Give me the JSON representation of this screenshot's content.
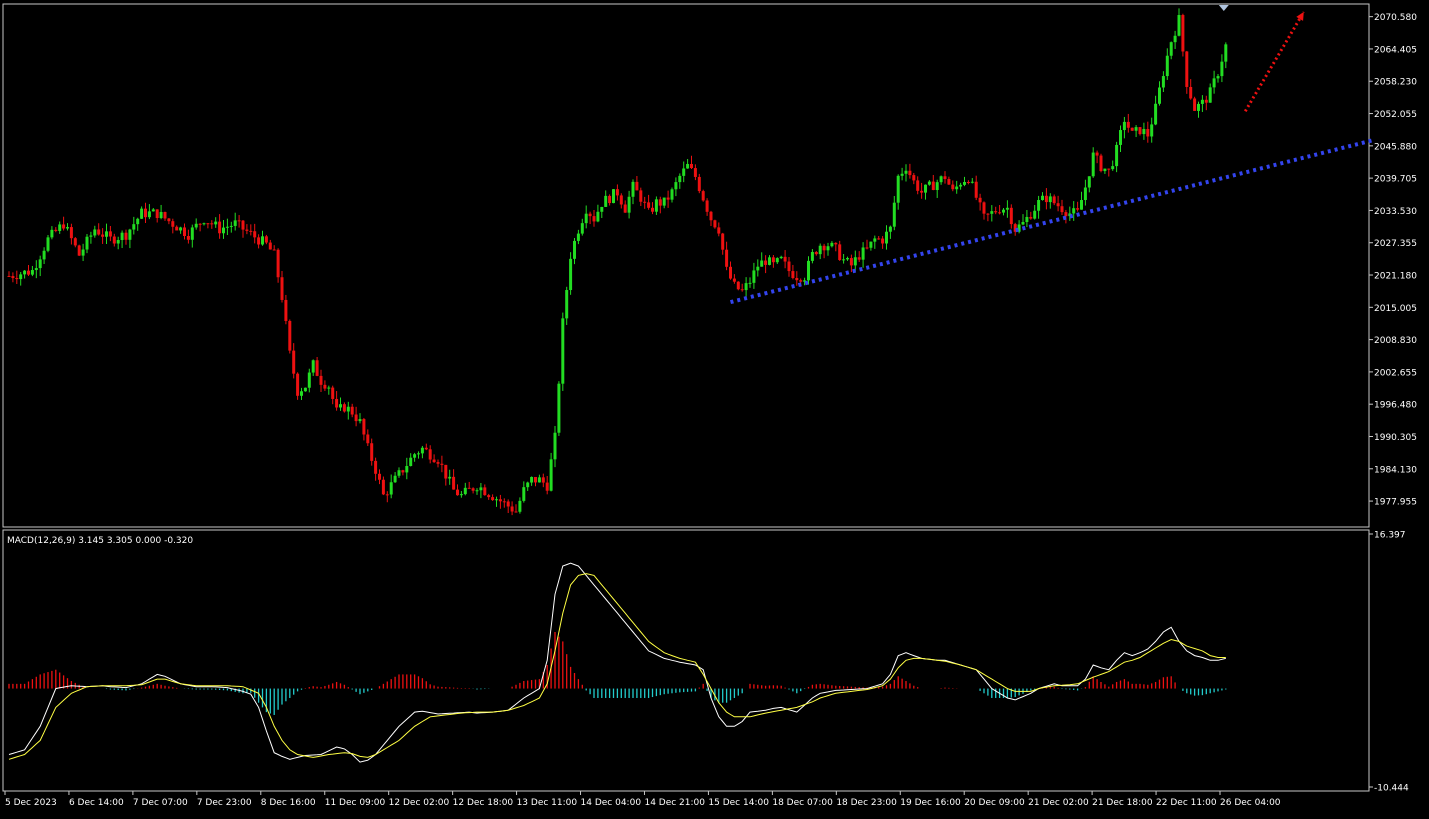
{
  "colors": {
    "background": "#000000",
    "frame": "#c8c8c8",
    "bull": "#22dd22",
    "bear": "#ee1111",
    "trendline": "#3344ee",
    "arrow": "#ee1111",
    "macd_line": "#ffffff",
    "signal_line": "#ffff44",
    "hist_pos": "#ee1111",
    "hist_neg": "#22cccc",
    "text": "#ffffff"
  },
  "chart_data": [
    {
      "type": "candlestick",
      "symbol_panel": "main",
      "ylim": [
        1973.0,
        2073.0
      ],
      "y_ticks": [
        "2070.580",
        "2064.405",
        "2058.230",
        "2052.055",
        "2045.880",
        "2039.705",
        "2033.530",
        "2027.355",
        "2021.180",
        "2015.005",
        "2008.830",
        "2002.655",
        "1996.480",
        "1990.305",
        "1984.130",
        "1977.955"
      ],
      "x_tick_labels": [
        "5 Dec 2023",
        "6 Dec 14:00",
        "7 Dec 07:00",
        "7 Dec 23:00",
        "8 Dec 16:00",
        "11 Dec 09:00",
        "12 Dec 02:00",
        "12 Dec 18:00",
        "13 Dec 11:00",
        "14 Dec 04:00",
        "14 Dec 21:00",
        "15 Dec 14:00",
        "18 Dec 07:00",
        "18 Dec 23:00",
        "19 Dec 16:00",
        "20 Dec 09:00",
        "21 Dec 02:00",
        "21 Dec 18:00",
        "22 Dec 11:00",
        "26 Dec 04:00"
      ],
      "close_path": [
        [
          0,
          2021
        ],
        [
          6,
          2022
        ],
        [
          10,
          2028
        ],
        [
          14,
          2031
        ],
        [
          18,
          2025
        ],
        [
          22,
          2030
        ],
        [
          26,
          2028
        ],
        [
          30,
          2029
        ],
        [
          34,
          2033
        ],
        [
          38,
          2033
        ],
        [
          42,
          2031
        ],
        [
          46,
          2029
        ],
        [
          50,
          2032
        ],
        [
          54,
          2030
        ],
        [
          58,
          2031
        ],
        [
          62,
          2029
        ],
        [
          66,
          2027
        ],
        [
          68,
          2025
        ],
        [
          70,
          2017
        ],
        [
          72,
          2006
        ],
        [
          74,
          1999
        ],
        [
          76,
          2000
        ],
        [
          78,
          2004
        ],
        [
          80,
          2001
        ],
        [
          82,
          2000
        ],
        [
          84,
          1995
        ],
        [
          86,
          1996
        ],
        [
          88,
          1995
        ],
        [
          90,
          1993
        ],
        [
          92,
          1988
        ],
        [
          94,
          1984
        ],
        [
          96,
          1979
        ],
        [
          98,
          1981
        ],
        [
          100,
          1983
        ],
        [
          102,
          1985
        ],
        [
          104,
          1987
        ],
        [
          106,
          1988
        ],
        [
          108,
          1987
        ],
        [
          110,
          1986
        ],
        [
          112,
          1983
        ],
        [
          114,
          1980
        ],
        [
          116,
          1979
        ],
        [
          118,
          1980
        ],
        [
          120,
          1981
        ],
        [
          122,
          1980
        ],
        [
          124,
          1979
        ],
        [
          126,
          1978
        ],
        [
          128,
          1977
        ],
        [
          130,
          1976
        ],
        [
          132,
          1980
        ],
        [
          134,
          1982
        ],
        [
          136,
          1982
        ],
        [
          138,
          1981
        ],
        [
          140,
          1990
        ],
        [
          142,
          2012
        ],
        [
          144,
          2025
        ],
        [
          146,
          2030
        ],
        [
          148,
          2034
        ],
        [
          150,
          2032
        ],
        [
          152,
          2035
        ],
        [
          154,
          2036
        ],
        [
          156,
          2037
        ],
        [
          158,
          2034
        ],
        [
          160,
          2038
        ],
        [
          162,
          2036
        ],
        [
          164,
          2033
        ],
        [
          166,
          2035
        ],
        [
          168,
          2035
        ],
        [
          170,
          2037
        ],
        [
          172,
          2040
        ],
        [
          174,
          2042
        ],
        [
          176,
          2040
        ],
        [
          178,
          2036
        ],
        [
          180,
          2032
        ],
        [
          182,
          2030
        ],
        [
          184,
          2022
        ],
        [
          186,
          2019
        ],
        [
          188,
          2018
        ],
        [
          190,
          2020
        ],
        [
          192,
          2023
        ],
        [
          194,
          2024
        ],
        [
          196,
          2023
        ],
        [
          198,
          2024
        ],
        [
          200,
          2022
        ],
        [
          202,
          2021
        ],
        [
          204,
          2021
        ],
        [
          206,
          2025
        ],
        [
          208,
          2027
        ],
        [
          210,
          2027
        ],
        [
          212,
          2026
        ],
        [
          214,
          2024
        ],
        [
          216,
          2023
        ],
        [
          218,
          2025
        ],
        [
          220,
          2026
        ],
        [
          222,
          2028
        ],
        [
          224,
          2028
        ],
        [
          226,
          2030
        ],
        [
          228,
          2040
        ],
        [
          230,
          2042
        ],
        [
          232,
          2039
        ],
        [
          234,
          2037
        ],
        [
          236,
          2038
        ],
        [
          238,
          2039
        ],
        [
          240,
          2040
        ],
        [
          242,
          2037
        ],
        [
          244,
          2039
        ],
        [
          246,
          2040
        ],
        [
          248,
          2036
        ],
        [
          250,
          2032
        ],
        [
          252,
          2033
        ],
        [
          254,
          2034
        ],
        [
          256,
          2034
        ],
        [
          258,
          2030
        ],
        [
          260,
          2031
        ],
        [
          262,
          2033
        ],
        [
          264,
          2035
        ],
        [
          266,
          2036
        ],
        [
          268,
          2035
        ],
        [
          270,
          2034
        ],
        [
          272,
          2033
        ],
        [
          274,
          2033
        ],
        [
          276,
          2038
        ],
        [
          278,
          2044
        ],
        [
          280,
          2042
        ],
        [
          282,
          2041
        ],
        [
          284,
          2045
        ],
        [
          286,
          2051
        ],
        [
          288,
          2048
        ],
        [
          290,
          2049
        ],
        [
          292,
          2048
        ],
        [
          294,
          2053
        ],
        [
          296,
          2060
        ],
        [
          298,
          2066
        ],
        [
          300,
          2070
        ],
        [
          302,
          2058
        ],
        [
          304,
          2053
        ],
        [
          306,
          2054
        ],
        [
          308,
          2056
        ],
        [
          310,
          2060
        ],
        [
          312,
          2065
        ]
      ],
      "trendline": {
        "from": [
          185,
          2016.0
        ],
        "to": [
          350,
          2047.0
        ]
      },
      "arrow": {
        "from": [
          317,
          2052.5
        ],
        "to": [
          332,
          2071.5
        ]
      }
    },
    {
      "type": "macd",
      "title": "MACD(12,26,9) 3.145 3.305 0.000 -0.320",
      "ylim": [
        -10.444,
        16.397
      ],
      "y_ticks": [
        "16.397",
        "-10.444"
      ],
      "macd_path": [
        [
          0,
          -7
        ],
        [
          4,
          -6.5
        ],
        [
          8,
          -4
        ],
        [
          12,
          0
        ],
        [
          16,
          0.3
        ],
        [
          20,
          0.2
        ],
        [
          24,
          0.3
        ],
        [
          26,
          0.2
        ],
        [
          30,
          0.1
        ],
        [
          34,
          0.5
        ],
        [
          38,
          1.5
        ],
        [
          40,
          1.3
        ],
        [
          44,
          0.5
        ],
        [
          48,
          0.2
        ],
        [
          52,
          0.2
        ],
        [
          56,
          0.1
        ],
        [
          60,
          -0.3
        ],
        [
          62,
          -0.6
        ],
        [
          64,
          -2
        ],
        [
          66,
          -4.5
        ],
        [
          68,
          -6.8
        ],
        [
          70,
          -7.2
        ],
        [
          72,
          -7.5
        ],
        [
          74,
          -7.3
        ],
        [
          76,
          -7.1
        ],
        [
          80,
          -7.0
        ],
        [
          84,
          -6.2
        ],
        [
          86,
          -6.4
        ],
        [
          88,
          -7.0
        ],
        [
          90,
          -7.8
        ],
        [
          92,
          -7.6
        ],
        [
          94,
          -7.0
        ],
        [
          96,
          -6.0
        ],
        [
          98,
          -5.0
        ],
        [
          100,
          -4.0
        ],
        [
          104,
          -2.5
        ],
        [
          106,
          -2.4
        ],
        [
          110,
          -2.7
        ],
        [
          114,
          -2.6
        ],
        [
          118,
          -2.5
        ],
        [
          120,
          -2.6
        ],
        [
          124,
          -2.5
        ],
        [
          128,
          -2.3
        ],
        [
          132,
          -1.0
        ],
        [
          134,
          -0.5
        ],
        [
          136,
          0
        ],
        [
          138,
          3
        ],
        [
          140,
          10
        ],
        [
          142,
          13.0
        ],
        [
          144,
          13.3
        ],
        [
          146,
          13.0
        ],
        [
          148,
          12.0
        ],
        [
          152,
          10.0
        ],
        [
          156,
          8.0
        ],
        [
          160,
          6.0
        ],
        [
          164,
          4.0
        ],
        [
          168,
          3.2
        ],
        [
          172,
          2.8
        ],
        [
          176,
          2.5
        ],
        [
          178,
          2.0
        ],
        [
          180,
          -1.0
        ],
        [
          182,
          -3.0
        ],
        [
          184,
          -4.0
        ],
        [
          186,
          -4.0
        ],
        [
          188,
          -3.5
        ],
        [
          190,
          -2.5
        ],
        [
          194,
          -2.3
        ],
        [
          196,
          -2.1
        ],
        [
          198,
          -2.0
        ],
        [
          202,
          -2.5
        ],
        [
          206,
          -1.0
        ],
        [
          208,
          -0.5
        ],
        [
          212,
          -0.2
        ],
        [
          216,
          -0.1
        ],
        [
          220,
          0
        ],
        [
          224,
          0.5
        ],
        [
          226,
          1.5
        ],
        [
          228,
          3.5
        ],
        [
          230,
          3.8
        ],
        [
          232,
          3.5
        ],
        [
          234,
          3.2
        ],
        [
          238,
          3.0
        ],
        [
          240,
          3.0
        ],
        [
          244,
          2.5
        ],
        [
          248,
          2.0
        ],
        [
          252,
          0
        ],
        [
          256,
          -1.0
        ],
        [
          258,
          -1.2
        ],
        [
          262,
          -0.5
        ],
        [
          264,
          0
        ],
        [
          268,
          0.5
        ],
        [
          270,
          0.3
        ],
        [
          274,
          0.3
        ],
        [
          276,
          1.0
        ],
        [
          278,
          2.5
        ],
        [
          280,
          2.2
        ],
        [
          282,
          2.0
        ],
        [
          284,
          3.0
        ],
        [
          286,
          3.8
        ],
        [
          288,
          3.5
        ],
        [
          290,
          3.8
        ],
        [
          292,
          4.2
        ],
        [
          294,
          5.0
        ],
        [
          296,
          6.0
        ],
        [
          298,
          6.5
        ],
        [
          300,
          5.0
        ],
        [
          302,
          4.0
        ],
        [
          304,
          3.5
        ],
        [
          306,
          3.3
        ],
        [
          308,
          3.0
        ],
        [
          310,
          3.0
        ],
        [
          312,
          3.2
        ]
      ],
      "signal_path": [
        [
          0,
          -7.5
        ],
        [
          4,
          -7
        ],
        [
          8,
          -5.5
        ],
        [
          12,
          -2
        ],
        [
          16,
          -0.5
        ],
        [
          20,
          0.2
        ],
        [
          24,
          0.3
        ],
        [
          30,
          0.3
        ],
        [
          34,
          0.4
        ],
        [
          38,
          1.0
        ],
        [
          40,
          1.0
        ],
        [
          44,
          0.5
        ],
        [
          48,
          0.3
        ],
        [
          52,
          0.3
        ],
        [
          56,
          0.3
        ],
        [
          60,
          0.2
        ],
        [
          64,
          -0.5
        ],
        [
          66,
          -2
        ],
        [
          68,
          -4.0
        ],
        [
          70,
          -5.5
        ],
        [
          72,
          -6.5
        ],
        [
          74,
          -7.0
        ],
        [
          78,
          -7.3
        ],
        [
          82,
          -7.0
        ],
        [
          86,
          -6.8
        ],
        [
          88,
          -6.9
        ],
        [
          90,
          -7.2
        ],
        [
          92,
          -7.3
        ],
        [
          94,
          -7.0
        ],
        [
          96,
          -6.5
        ],
        [
          100,
          -5.5
        ],
        [
          104,
          -4.0
        ],
        [
          108,
          -3.0
        ],
        [
          112,
          -2.8
        ],
        [
          116,
          -2.6
        ],
        [
          120,
          -2.5
        ],
        [
          124,
          -2.5
        ],
        [
          128,
          -2.3
        ],
        [
          132,
          -1.8
        ],
        [
          136,
          -1.0
        ],
        [
          138,
          0.5
        ],
        [
          140,
          4.0
        ],
        [
          142,
          8.0
        ],
        [
          144,
          11.0
        ],
        [
          146,
          12.0
        ],
        [
          148,
          12.2
        ],
        [
          150,
          12.0
        ],
        [
          152,
          11.0
        ],
        [
          156,
          9.0
        ],
        [
          160,
          7.0
        ],
        [
          164,
          5.0
        ],
        [
          168,
          3.8
        ],
        [
          172,
          3.2
        ],
        [
          176,
          2.8
        ],
        [
          178,
          1.5
        ],
        [
          180,
          0
        ],
        [
          182,
          -1.5
        ],
        [
          184,
          -2.5
        ],
        [
          186,
          -3.0
        ],
        [
          190,
          -3.0
        ],
        [
          194,
          -2.6
        ],
        [
          198,
          -2.3
        ],
        [
          202,
          -2.0
        ],
        [
          206,
          -1.4
        ],
        [
          208,
          -1.0
        ],
        [
          212,
          -0.5
        ],
        [
          216,
          -0.3
        ],
        [
          220,
          -0.1
        ],
        [
          224,
          0.3
        ],
        [
          226,
          1.0
        ],
        [
          228,
          2.2
        ],
        [
          230,
          3.0
        ],
        [
          232,
          3.2
        ],
        [
          234,
          3.2
        ],
        [
          238,
          3.0
        ],
        [
          240,
          2.9
        ],
        [
          244,
          2.5
        ],
        [
          248,
          2.0
        ],
        [
          252,
          1.0
        ],
        [
          256,
          0
        ],
        [
          258,
          -0.3
        ],
        [
          262,
          -0.3
        ],
        [
          264,
          0
        ],
        [
          268,
          0.3
        ],
        [
          272,
          0.4
        ],
        [
          274,
          0.5
        ],
        [
          278,
          1.2
        ],
        [
          282,
          1.8
        ],
        [
          284,
          2.3
        ],
        [
          286,
          2.8
        ],
        [
          288,
          3.0
        ],
        [
          290,
          3.3
        ],
        [
          292,
          3.8
        ],
        [
          294,
          4.3
        ],
        [
          296,
          4.8
        ],
        [
          298,
          5.2
        ],
        [
          300,
          5.0
        ],
        [
          302,
          4.5
        ],
        [
          306,
          4.0
        ],
        [
          308,
          3.5
        ],
        [
          310,
          3.3
        ],
        [
          312,
          3.3
        ]
      ]
    }
  ]
}
